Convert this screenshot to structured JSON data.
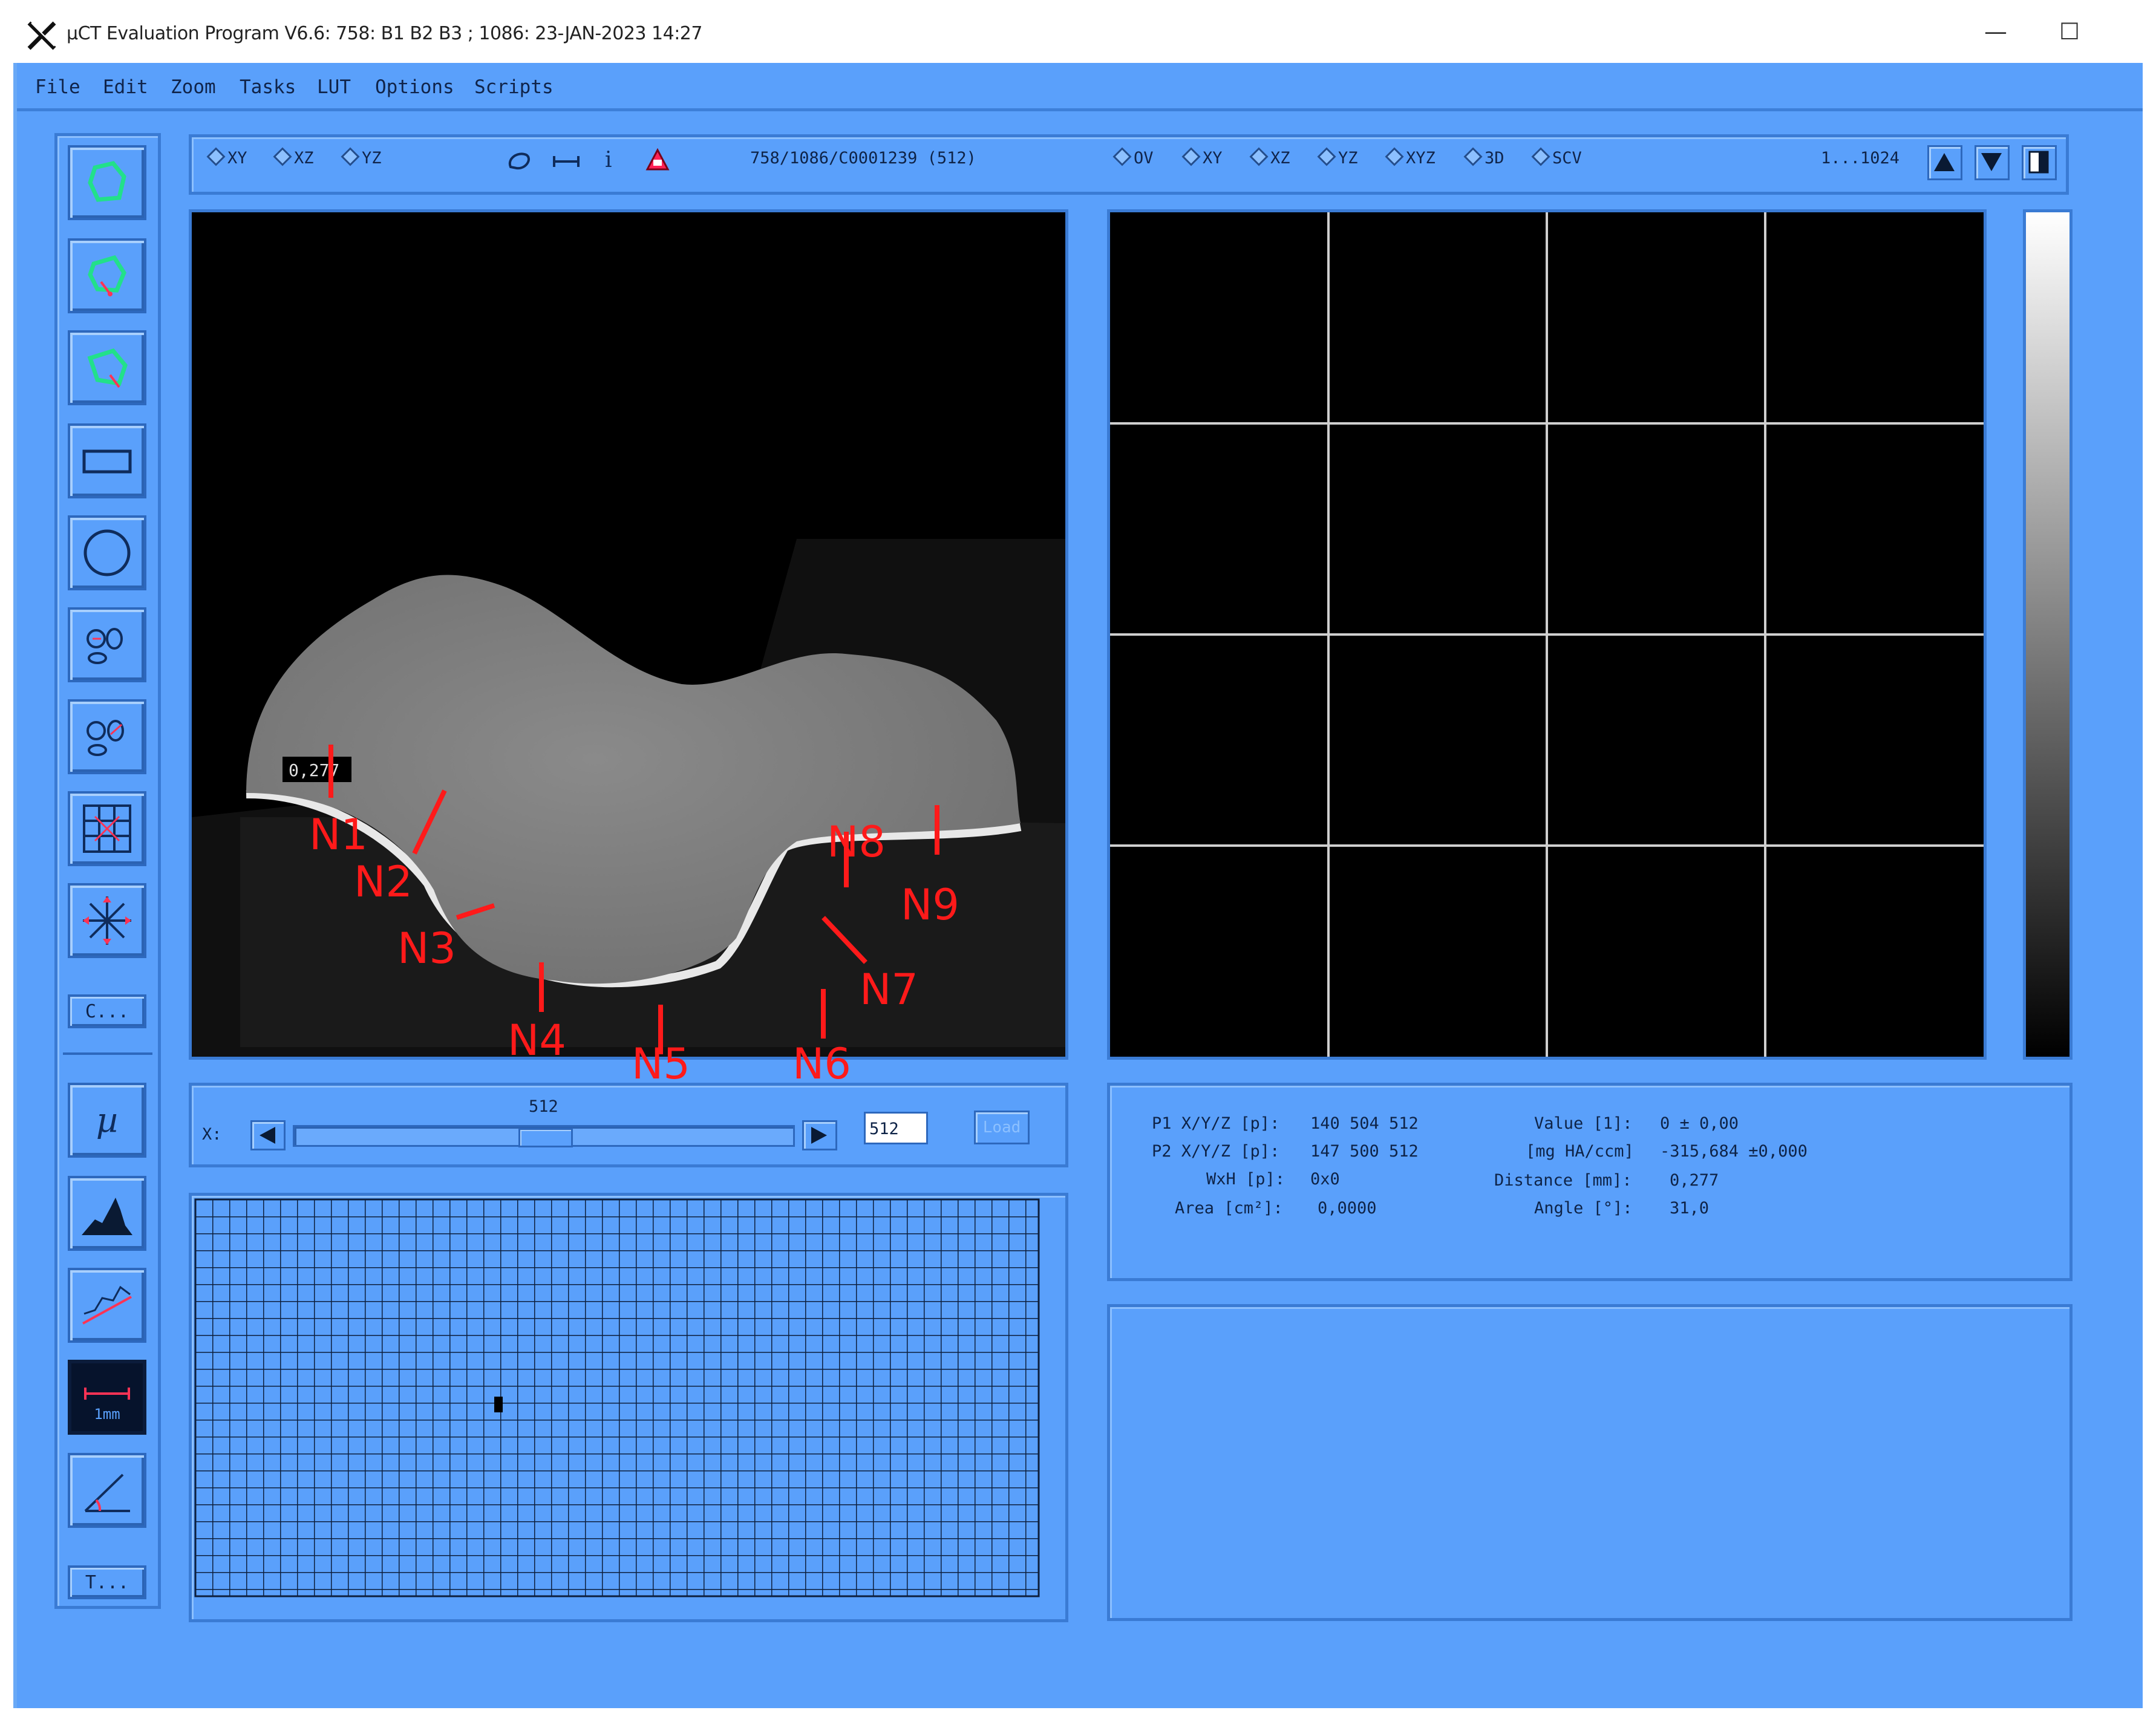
{
  "window": {
    "title": "µCT Evaluation Program V6.6: 758: B1 B2 B3 ; 1086: 23-JAN-2023 14:27",
    "minimize": "—",
    "maximize": "☐"
  },
  "menu": [
    "File",
    "Edit",
    "Zoom",
    "Tasks",
    "LUT",
    "Options",
    "Scripts"
  ],
  "toolbar": {
    "view_planes": [
      "XY",
      "XZ",
      "YZ"
    ],
    "info_text": "758/1086/C0001239 (512)",
    "display_modes": [
      "OV",
      "XY",
      "XZ",
      "YZ",
      "XYZ",
      "3D",
      "SCV"
    ],
    "range": "1...1024"
  },
  "left_tools": {
    "c_button": "C...",
    "t_button": "T...",
    "mu_label": "µ",
    "scale_label": "1mm"
  },
  "image": {
    "measurement_label": "0,277",
    "annotations": [
      "N1",
      "N2",
      "N3",
      "N4",
      "N5",
      "N6",
      "N7",
      "N8",
      "N9"
    ]
  },
  "slider": {
    "axis_label": "X:",
    "position_label": "512",
    "input_value": "512",
    "load_label": "Load"
  },
  "measurements": {
    "p1_label": "P1 X/Y/Z [p]:",
    "p1_value": "140 504 512",
    "p2_label": "P2 X/Y/Z [p]:",
    "p2_value": "147 500 512",
    "wxh_label": "WxH [p]:",
    "wxh_value": "0x0",
    "area_label": "Area [cm²]:",
    "area_value": "0,0000",
    "value_label": "Value [1]:",
    "value_value": "0 ±   0,00",
    "mg_label": "[mg HA/ccm]",
    "mg_value": "-315,684 ±0,000",
    "distance_label": "Distance [mm]:",
    "distance_value": "0,277",
    "angle_label": "Angle [°]:",
    "angle_value": "31,0"
  },
  "colors": {
    "app_bg": "#5aa0fb",
    "annotation": "#ff1a1a",
    "roi_outline": "#22e08a"
  }
}
